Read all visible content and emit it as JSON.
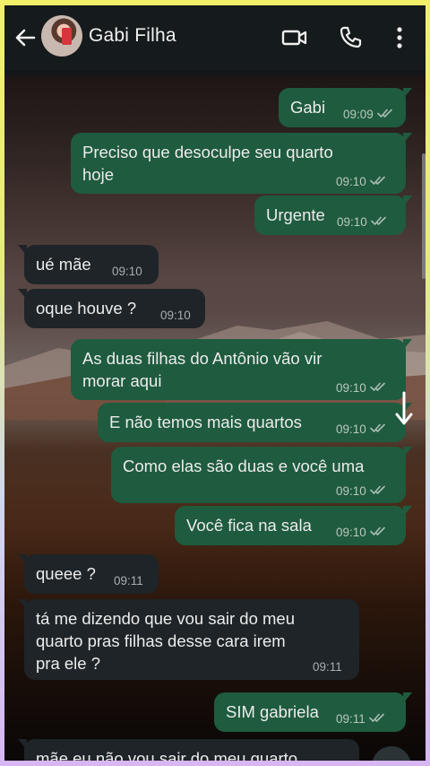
{
  "header": {
    "contact_name": "Gabi Filha",
    "icons": [
      "back-arrow-icon",
      "avatar",
      "video-call-icon",
      "phone-call-icon",
      "more-vert-icon"
    ]
  },
  "colors": {
    "header_bg": "#151a1c",
    "outgoing_bubble": "#1f5b3e",
    "incoming_bubble": "#1e2428",
    "frame_gradient": [
      "#f2f06a",
      "#cfd8ef",
      "#d7b6f2"
    ]
  },
  "messages": [
    {
      "dir": "out",
      "text": "Gabi",
      "time": "09:09",
      "read": true
    },
    {
      "dir": "out",
      "text": "Preciso que desoculpe seu quarto\nhoje",
      "time": "09:10",
      "read": true
    },
    {
      "dir": "out",
      "text": "Urgente",
      "time": "09:10",
      "read": true
    },
    {
      "dir": "in",
      "text": "ué mãe",
      "time": "09:10"
    },
    {
      "dir": "in",
      "text": "oque houve ?",
      "time": "09:10"
    },
    {
      "dir": "out",
      "text": "As duas filhas do Antônio vão vir\nmorar aqui",
      "time": "09:10",
      "read": true
    },
    {
      "dir": "out",
      "text": "E não temos mais quartos",
      "time": "09:10",
      "read": true
    },
    {
      "dir": "out",
      "text": "Como elas são duas e você uma",
      "time": "09:10",
      "read": true
    },
    {
      "dir": "out",
      "text": "Você fica na sala",
      "time": "09:10",
      "read": true
    },
    {
      "dir": "in",
      "text": "queee ?",
      "time": "09:11"
    },
    {
      "dir": "in",
      "text": "tá me dizendo que vou sair do meu\nquarto pras filhas desse cara irem\npra ele ?",
      "time": "09:11"
    },
    {
      "dir": "out",
      "text": "SIM gabriela",
      "time": "09:11",
      "read": true
    },
    {
      "dir": "in",
      "text": "mãe eu não vou sair do meu quarto",
      "time": ""
    }
  ]
}
